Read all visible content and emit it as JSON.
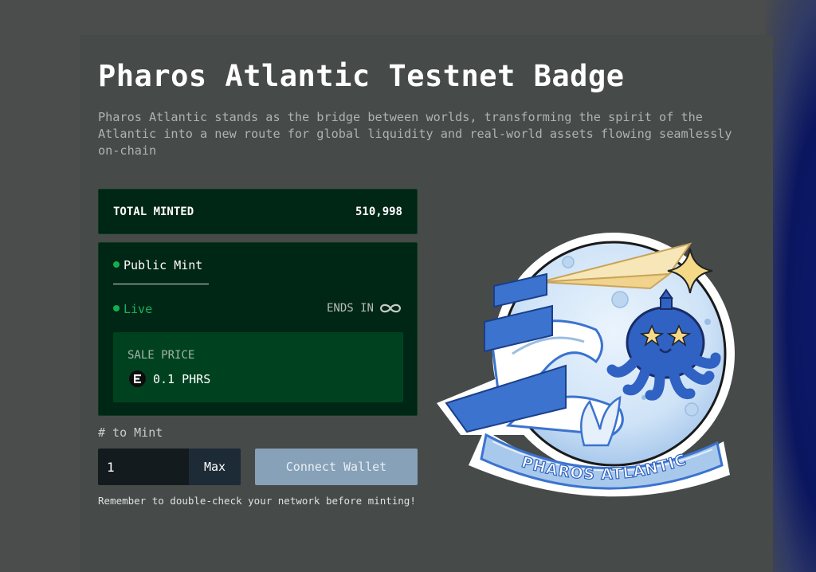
{
  "page": {
    "title": "Pharos Atlantic Testnet Badge",
    "description": "Pharos Atlantic stands as the bridge between worlds, transforming the spirit of the Atlantic into a new route for global liquidity and real-world assets flowing seamlessly on-chain"
  },
  "stats": {
    "total_minted_label": "TOTAL MINTED",
    "total_minted_value": "510,998"
  },
  "mint_phase": {
    "name": "Public Mint",
    "status": "Live",
    "ends_label": "ENDS IN",
    "ends_icon": "infinity-icon",
    "sale_price_label": "SALE PRICE",
    "price": "0.1 PHRS",
    "currency_icon": "phrs-coin-icon"
  },
  "mint_form": {
    "quantity_label": "# to Mint",
    "quantity_value": "1",
    "max_label": "Max",
    "connect_label": "Connect Wallet",
    "note": "Remember to double-check your network before minting!"
  },
  "badge_image": {
    "banner_text": "PHAROS ATLANTIC"
  },
  "colors": {
    "background": "#4a4d4c",
    "card": "#002616",
    "price_box": "#004220",
    "live_green": "#17b35a",
    "connect_button": "#86a1b8",
    "badge_blue": "#3b73cf"
  }
}
